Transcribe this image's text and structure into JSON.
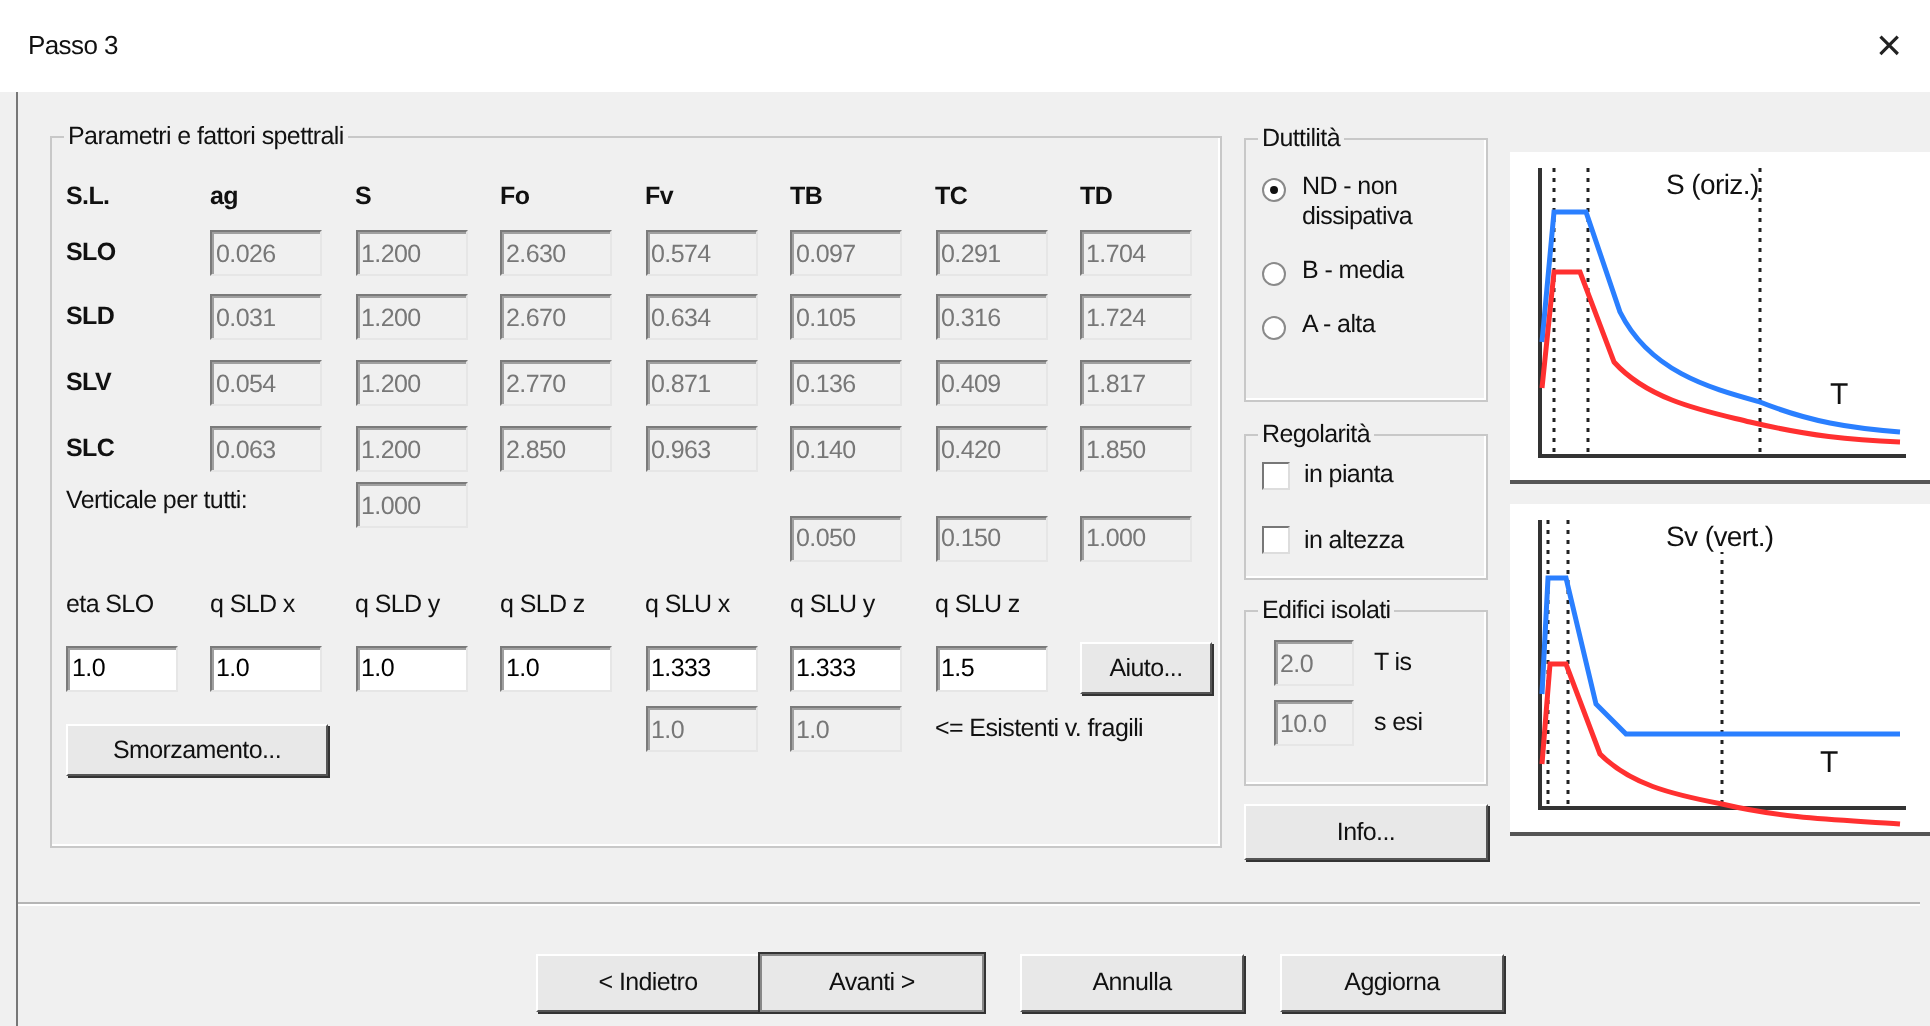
{
  "window": {
    "title": "Passo 3",
    "close": "×"
  },
  "spectral": {
    "title": "Parametri e fattori spettrali",
    "columns": [
      "S.L.",
      "ag",
      "S",
      "Fo",
      "Fv",
      "TB",
      "TC",
      "TD"
    ],
    "rows": [
      {
        "label": "SLO",
        "values": [
          "0.026",
          "1.200",
          "2.630",
          "0.574",
          "0.097",
          "0.291",
          "1.704"
        ]
      },
      {
        "label": "SLD",
        "values": [
          "0.031",
          "1.200",
          "2.670",
          "0.634",
          "0.105",
          "0.316",
          "1.724"
        ]
      },
      {
        "label": "SLV",
        "values": [
          "0.054",
          "1.200",
          "2.770",
          "0.871",
          "0.136",
          "0.409",
          "1.817"
        ]
      },
      {
        "label": "SLC",
        "values": [
          "0.063",
          "1.200",
          "2.850",
          "0.963",
          "0.140",
          "0.420",
          "1.850"
        ]
      }
    ],
    "vertical": {
      "label": "Verticale per tutti:",
      "s": "1.000",
      "tb": "0.050",
      "tc": "0.150",
      "td": "1.000"
    },
    "q_labels": [
      "eta SLO",
      "q SLD x",
      "q SLD y",
      "q SLD z",
      "q SLU x",
      "q SLU y",
      "q SLU z"
    ],
    "q_values": [
      {
        "value": "1.0",
        "disabled": false
      },
      {
        "value": "1.0",
        "disabled": false
      },
      {
        "value": "1.0",
        "disabled": false
      },
      {
        "value": "1.0",
        "disabled": false
      },
      {
        "value": "1.333",
        "disabled": false
      },
      {
        "value": "1.333",
        "disabled": false
      },
      {
        "value": "1.5",
        "disabled": false
      }
    ],
    "help_button": "Aiuto...",
    "fragile_values": [
      {
        "value": "1.0",
        "disabled": true
      },
      {
        "value": "1.0",
        "disabled": true
      }
    ],
    "fragile_note": "<= Esistenti v. fragili",
    "damping_button": "Smorzamento..."
  },
  "ductility": {
    "title": "Duttilità",
    "options": [
      {
        "label": "ND - non dissipativa",
        "selected": true
      },
      {
        "label": "B - media",
        "selected": false
      },
      {
        "label": "A - alta",
        "selected": false
      }
    ]
  },
  "regularity": {
    "title": "Regolarità",
    "options": [
      {
        "label": "in pianta",
        "checked": false
      },
      {
        "label": "in altezza",
        "checked": false
      }
    ]
  },
  "isolated": {
    "title": "Edifici isolati",
    "fields": [
      {
        "value": "2.0",
        "label": "T is",
        "disabled": true
      },
      {
        "value": "10.0",
        "label": "s esi",
        "disabled": true
      }
    ]
  },
  "info_button": "Info...",
  "charts": [
    {
      "kind": "horizontal",
      "title": "S (oriz.)",
      "axis_label": "T"
    },
    {
      "kind": "vertical",
      "title": "Sv (vert.)",
      "axis_label": "T"
    }
  ],
  "buttons": [
    {
      "label": "< Indietro",
      "default": false
    },
    {
      "label": "Avanti >",
      "default": true
    },
    {
      "label": "Annulla",
      "default": false
    },
    {
      "label": "Aggiorna",
      "default": false
    }
  ]
}
